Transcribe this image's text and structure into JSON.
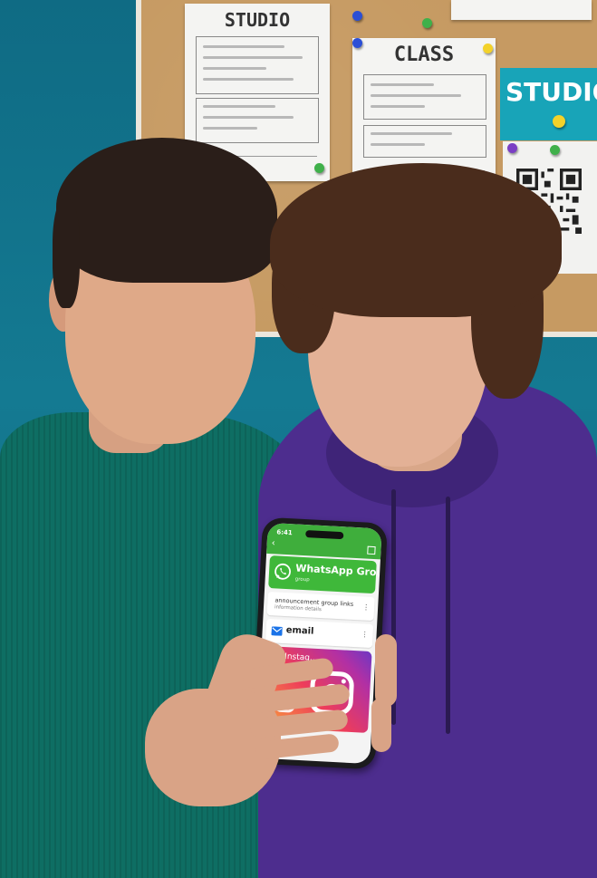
{
  "board": {
    "poster_left_title": "STUDIO",
    "poster_center_title": "CLASS",
    "sign_text": "STUDIO"
  },
  "phone": {
    "status_time": "6:41",
    "whatsapp": {
      "title": "WhatsApp Group",
      "subtitle": "group"
    },
    "row_text": {
      "primary": "announcement group links",
      "secondary": "information details"
    },
    "email": {
      "label": "email"
    },
    "instagram": {
      "label": "Instag..."
    },
    "colors": {
      "whatsapp_green": "#3fb83a",
      "instagram_orange": "#f9a53a",
      "instagram_pink": "#ee3d5a",
      "instagram_purple": "#6d38c4",
      "email_blue": "#1a73e8"
    }
  }
}
